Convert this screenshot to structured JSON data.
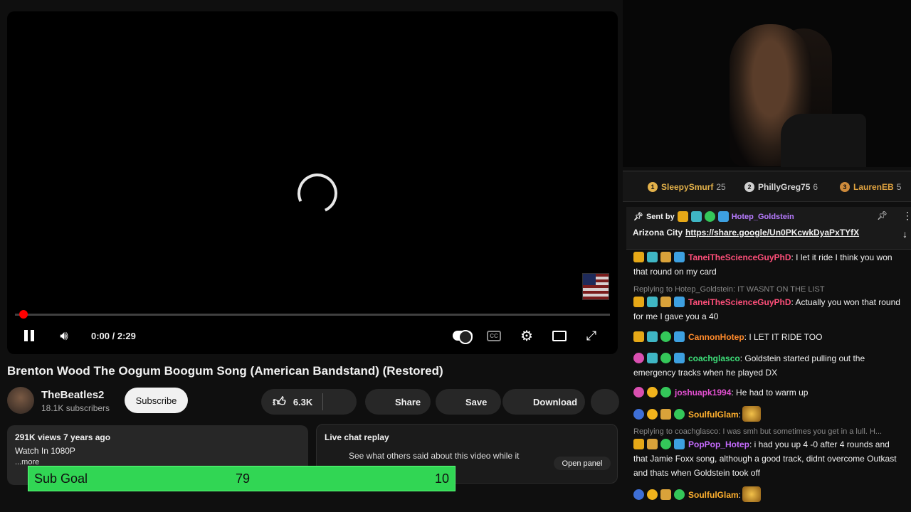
{
  "player": {
    "time": "0:00 / 2:29",
    "progress_fraction": 0.0,
    "cc_label": "CC"
  },
  "video": {
    "title": "Brenton Wood The Oogum Boogum Song (American Bandstand) (Restored)",
    "channel_name": "TheBeatles2",
    "channel_subs": "18.1K subscribers",
    "subscribe_label": "Subscribe",
    "like_count": "6.3K",
    "share_label": "Share",
    "save_label": "Save",
    "download_label": "Download"
  },
  "description": {
    "stats": "291K views  7 years ago",
    "line2": "Watch In 1080P",
    "more": "...more"
  },
  "live_chat_replay": {
    "title": "Live chat replay",
    "text": "See what others said about this video while it",
    "button": "Open panel"
  },
  "sub_goal": {
    "label": "Sub Goal",
    "current": "79",
    "target": "10"
  },
  "top_donors": [
    {
      "rank": "1",
      "name": "SleepySmurf",
      "amount": "25",
      "color": "#e3b14a"
    },
    {
      "rank": "2",
      "name": "PhillyGreg75",
      "amount": "6",
      "color": "#d8d8d8"
    },
    {
      "rank": "3",
      "name": "LaurenEB",
      "amount": "5",
      "color": "#e0a340"
    }
  ],
  "pinned": {
    "sent_by": "Sent by",
    "user": "Hotep_Goldstein",
    "message": "Arizona City",
    "link": "https://share.google/Un0PKcwkDyaPxTYfX"
  },
  "chat": {
    "messages": [
      {
        "user": "TaneiTheScienceGuyPhD",
        "color": "#ff4f7a",
        "text": ": I let it ride I think you won that round on my card"
      },
      {
        "reply": "Replying to Hotep_Goldstein: IT WASNT ON THE LIST"
      },
      {
        "user": "TaneiTheScienceGuyPhD",
        "color": "#ff4f7a",
        "text": ": Actually you won that round for me I gave you a 40"
      },
      {
        "user": "CannonHotep",
        "color": "#ff8a2b",
        "text": ": I LET IT RIDE TOO"
      },
      {
        "user": "coachglasco",
        "color": "#3ee07a",
        "text": ": Goldstein started pulling out the emergency tracks when he played DX"
      },
      {
        "user": "joshuapk1994",
        "color": "#e24fd0",
        "text": ": He had to warm up"
      },
      {
        "user": "SoulfulGlam",
        "color": "#ffb02e",
        "text": ":"
      },
      {
        "reply": "Replying to coachglasco: I was smh but sometimes you get in a lull. H..."
      },
      {
        "user": "PopPop_Hotep",
        "color": "#c66bff",
        "text": ": i had you up 4 -0 after 4 rounds and that Jamie Foxx song, although a good track, didnt overcome Outkast and thats when Goldstein took off"
      },
      {
        "user": "SoulfulGlam",
        "color": "#ffb02e",
        "text": ":"
      }
    ]
  }
}
